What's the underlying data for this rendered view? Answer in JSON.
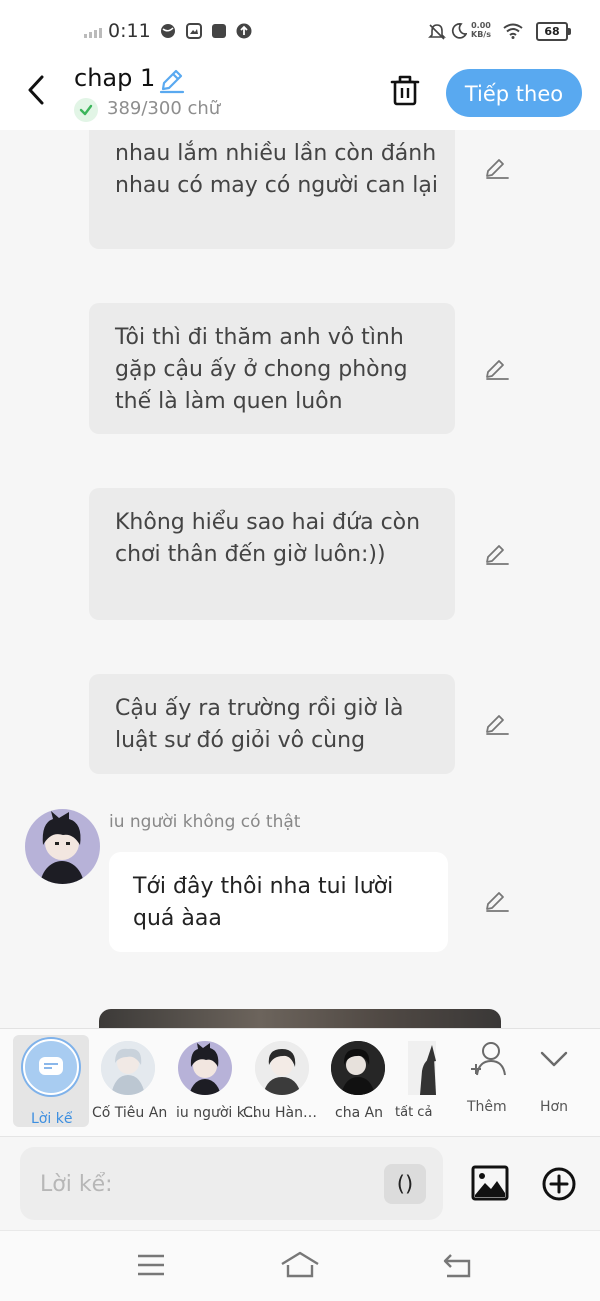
{
  "status_bar": {
    "time": "0:11",
    "net_speed_value": "0.00",
    "net_speed_unit": "KB/s",
    "battery": "68",
    "icons": [
      "signal-icon",
      "globe-icon",
      "gallery-icon",
      "square-icon",
      "upload-icon",
      "bell-off-icon",
      "moon-icon",
      "wifi-icon",
      "battery-icon"
    ]
  },
  "header": {
    "title": "chap 1",
    "word_count": "389/300 chữ",
    "next_button": "Tiếp theo",
    "accent": "#59a9f0"
  },
  "messages": [
    {
      "text": "nhau lắm nhiều lần còn đánh nhau có may có người can lại",
      "style": "narration"
    },
    {
      "text": "Tôi thì đi thăm anh vô tình gặp cậu ấy ở chong phòng thế là làm quen luôn",
      "style": "narration"
    },
    {
      "text": "Không hiểu sao hai đứa còn chơi thân đến giờ luôn:))",
      "style": "narration"
    },
    {
      "text": "Cậu ấy ra trường rồi giờ là luật sư đó giỏi vô cùng",
      "style": "narration"
    },
    {
      "speaker": "iu người không có thật",
      "text": "Tới đây thôi nha tui lười quá àaa",
      "style": "dialogue"
    }
  ],
  "characters": [
    {
      "label": "Lời kể",
      "selected": true
    },
    {
      "label": "Cố Tiêu An"
    },
    {
      "label": "iu người k..."
    },
    {
      "label": "Chu Hàng ..."
    },
    {
      "label": "cha An"
    },
    {
      "label": "tất cả"
    }
  ],
  "picker_tools": {
    "add_label": "Thêm",
    "more_label": "Hơn"
  },
  "composer": {
    "placeholder": "Lời kể:",
    "paren_label": "()"
  },
  "colors": {
    "background": "#f6f6f6",
    "bubble": "#ebebeb",
    "selected_tab": "#7fb2ea"
  }
}
